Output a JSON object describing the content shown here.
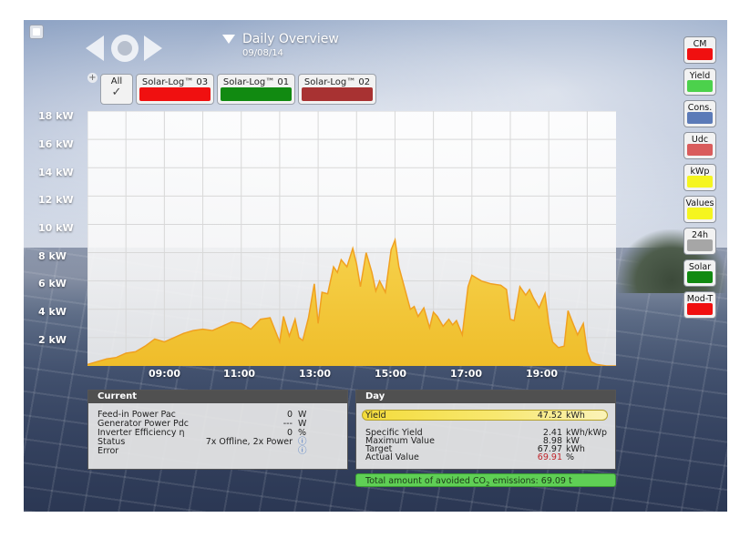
{
  "header": {
    "title": "Daily Overview",
    "date": "09/08/14"
  },
  "inverters": {
    "all_label": "All",
    "all_check": "✓",
    "tabs": [
      {
        "label": "Solar-Log™ 03",
        "color": "#f01010"
      },
      {
        "label": "Solar-Log™ 01",
        "color": "#118a11"
      },
      {
        "label": "Solar-Log™ 02",
        "color": "#a83232"
      }
    ]
  },
  "chart_data": {
    "type": "area",
    "yticks": [
      "18 kW",
      "16 kW",
      "14 kW",
      "12 kW",
      "10 kW",
      "8 kW",
      "6 kW",
      "4 kW",
      "2 kW"
    ],
    "xticks": [
      "09:00",
      "11:00",
      "13:00",
      "15:00",
      "17:00",
      "19:00"
    ],
    "ylim": [
      0,
      18
    ],
    "xlim": [
      7.0,
      20.75
    ],
    "unit": "kW",
    "fill_color": "#f0c33a",
    "line_color": "#f0a020",
    "grid": true,
    "series": [
      {
        "x": [
          7.0,
          7.25,
          7.5,
          7.75,
          8.0,
          8.25,
          8.5,
          8.75,
          9.0,
          9.25,
          9.5,
          9.75,
          10.0,
          10.25,
          10.5,
          10.75,
          11.0,
          11.25,
          11.5,
          11.75,
          12.0,
          12.1,
          12.25,
          12.4,
          12.5,
          12.6,
          12.75,
          12.9,
          13.0,
          13.1,
          13.25,
          13.4,
          13.5,
          13.6,
          13.75,
          13.9,
          14.0,
          14.1,
          14.25,
          14.4,
          14.5,
          14.6,
          14.75,
          14.9,
          15.0,
          15.1,
          15.25,
          15.4,
          15.5,
          15.6,
          15.75,
          15.9,
          16.0,
          16.1,
          16.25,
          16.4,
          16.5,
          16.6,
          16.75,
          16.9,
          17.0,
          17.25,
          17.5,
          17.75,
          17.9,
          18.0,
          18.1,
          18.25,
          18.4,
          18.5,
          18.6,
          18.75,
          18.9,
          19.0,
          19.1,
          19.25,
          19.4,
          19.5,
          19.6,
          19.75,
          19.9,
          20.0,
          20.1,
          20.25,
          20.5,
          20.75
        ],
        "y": [
          0.1,
          0.3,
          0.5,
          0.6,
          0.9,
          1.0,
          1.4,
          1.9,
          1.7,
          2.0,
          2.3,
          2.5,
          2.6,
          2.5,
          2.8,
          3.1,
          3.0,
          2.6,
          3.3,
          3.4,
          1.7,
          3.5,
          2.1,
          3.3,
          2.0,
          1.8,
          3.4,
          5.8,
          3.0,
          5.2,
          5.1,
          7.0,
          6.6,
          7.5,
          7.0,
          8.3,
          7.2,
          5.6,
          8.0,
          6.6,
          5.3,
          6.0,
          5.2,
          8.2,
          8.9,
          7.0,
          5.5,
          4.0,
          4.2,
          3.5,
          4.1,
          2.7,
          3.8,
          3.5,
          2.8,
          3.3,
          2.9,
          3.2,
          2.2,
          5.6,
          6.4,
          6.0,
          5.8,
          5.7,
          5.4,
          3.3,
          3.2,
          5.6,
          5.0,
          5.4,
          4.8,
          4.1,
          5.1,
          3.0,
          1.7,
          1.3,
          1.4,
          3.9,
          3.2,
          2.2,
          3.0,
          1.0,
          0.3,
          0.1,
          0.0,
          0.0
        ]
      }
    ]
  },
  "current": {
    "title": "Current",
    "rows": [
      {
        "label": "Feed-in Power Pac",
        "value": "0",
        "unit": "W"
      },
      {
        "label": "Generator Power Pdc",
        "value": "---",
        "unit": "W"
      },
      {
        "label": "Inverter Efficiency η",
        "value": "0",
        "unit": "%"
      },
      {
        "label": "Status",
        "value": "7x Offline, 2x Power",
        "unit": "ⓘ"
      },
      {
        "label": "Error",
        "value": "",
        "unit": "ⓘ"
      }
    ]
  },
  "day": {
    "title": "Day",
    "yield": {
      "label": "Yield",
      "value": "47.52",
      "unit": "kWh"
    },
    "rows": [
      {
        "label": "Specific Yield",
        "value": "2.41",
        "unit": "kWh/kWp"
      },
      {
        "label": "Maximum Value",
        "value": "8.98",
        "unit": "kW"
      },
      {
        "label": "Target",
        "value": "67.97",
        "unit": "kWh"
      },
      {
        "label": "Actual Value",
        "value": "69.91",
        "unit": "%"
      }
    ],
    "actual_value_color": "#c0262c"
  },
  "co2": {
    "text_prefix": "Total amount of avoided CO",
    "subscript": "2",
    "text_suffix": "emissions: 69.09 t"
  },
  "sidebar": [
    {
      "label": "CM",
      "color": "#f01010"
    },
    {
      "label": "Yield",
      "color": "#4cd14c"
    },
    {
      "label": "Cons.",
      "color": "#5b7ab8"
    },
    {
      "label": "Udc",
      "color": "#d95c5c"
    },
    {
      "label": "kWp",
      "color": "#f5f51f"
    },
    {
      "label": "Values",
      "color": "#f5f51f"
    },
    {
      "label": "24h",
      "color": "#a6a6a6"
    },
    {
      "label": "Solar",
      "color": "#118a11"
    },
    {
      "label": "Mod-T",
      "color": "#f01010"
    }
  ]
}
